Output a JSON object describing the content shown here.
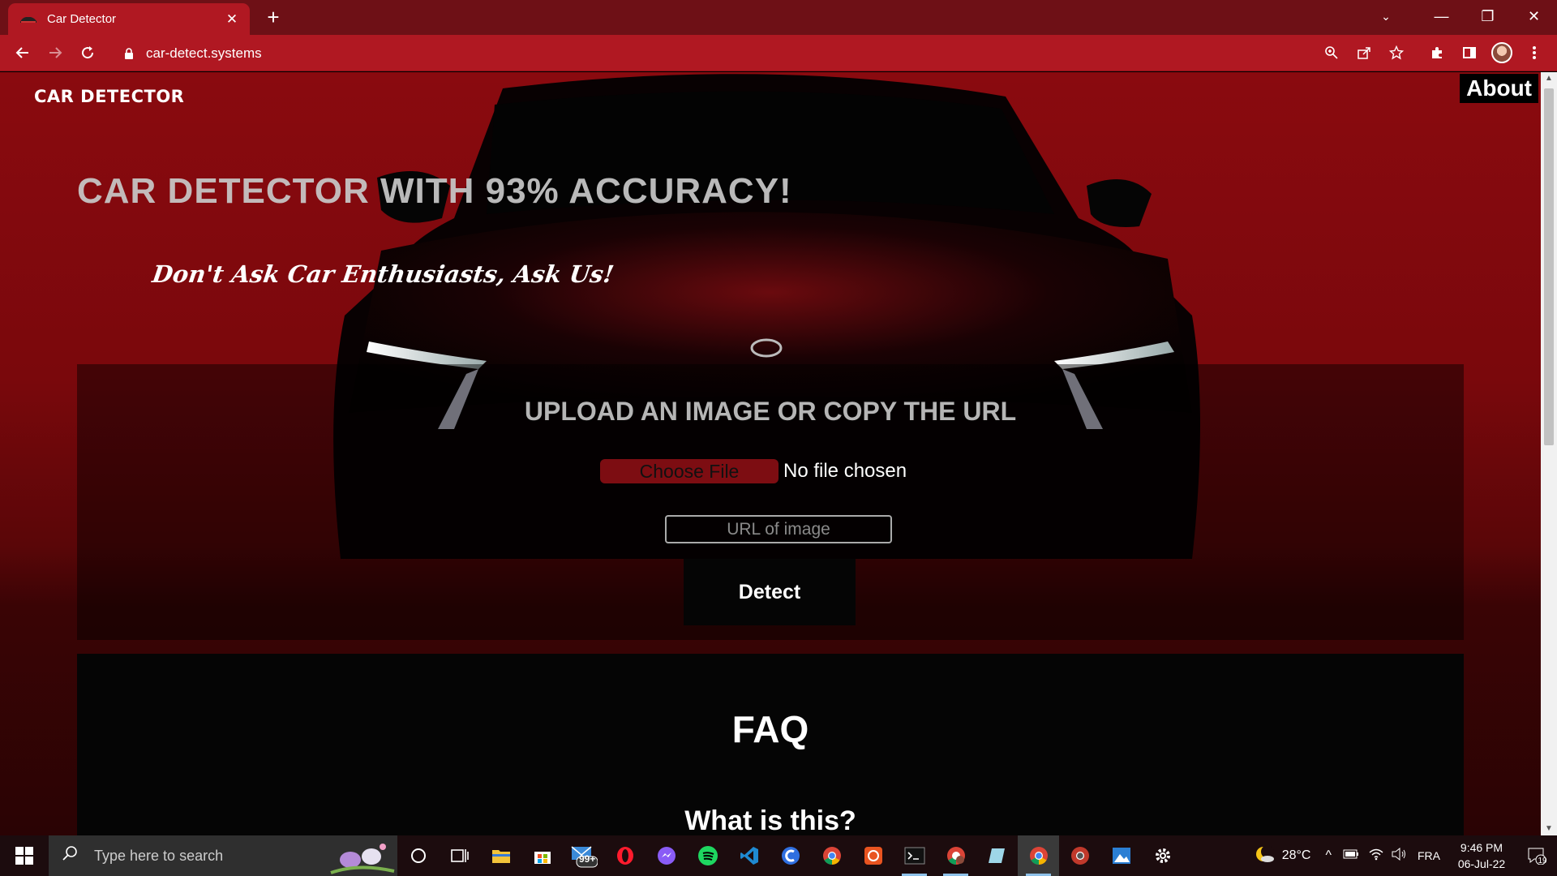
{
  "browser": {
    "tab_title": "Car Detector",
    "tab_close": "✕",
    "new_tab": "+",
    "url": "car-detect.systems",
    "window_controls": {
      "dropdown": "⌄",
      "minimize": "—",
      "restore": "❐",
      "close": "✕"
    }
  },
  "page": {
    "logo": "CAR DETECTOR",
    "about": "About",
    "hero_title": "CAR DETECTOR WITH 93% ACCURACY!",
    "tagline": "Don't Ask Car Enthusiasts, Ask Us!",
    "upload": {
      "title": "UPLOAD AN IMAGE OR COPY THE URL",
      "choose_file": "Choose File",
      "file_status": "No file chosen",
      "url_placeholder": "URL of image",
      "detect": "Detect"
    },
    "faq": {
      "title": "FAQ",
      "first_question": "What is this?"
    }
  },
  "taskbar": {
    "search_placeholder": "Type here to search",
    "mail_badge": "99+",
    "weather": "28°C",
    "language": "FRA",
    "time": "9:46 PM",
    "date": "06-Jul-22",
    "notifications": "19"
  },
  "colors": {
    "accent_red": "#b01822",
    "page_red": "#8a0a0f",
    "choose_file_bg": "#7d0d12"
  }
}
